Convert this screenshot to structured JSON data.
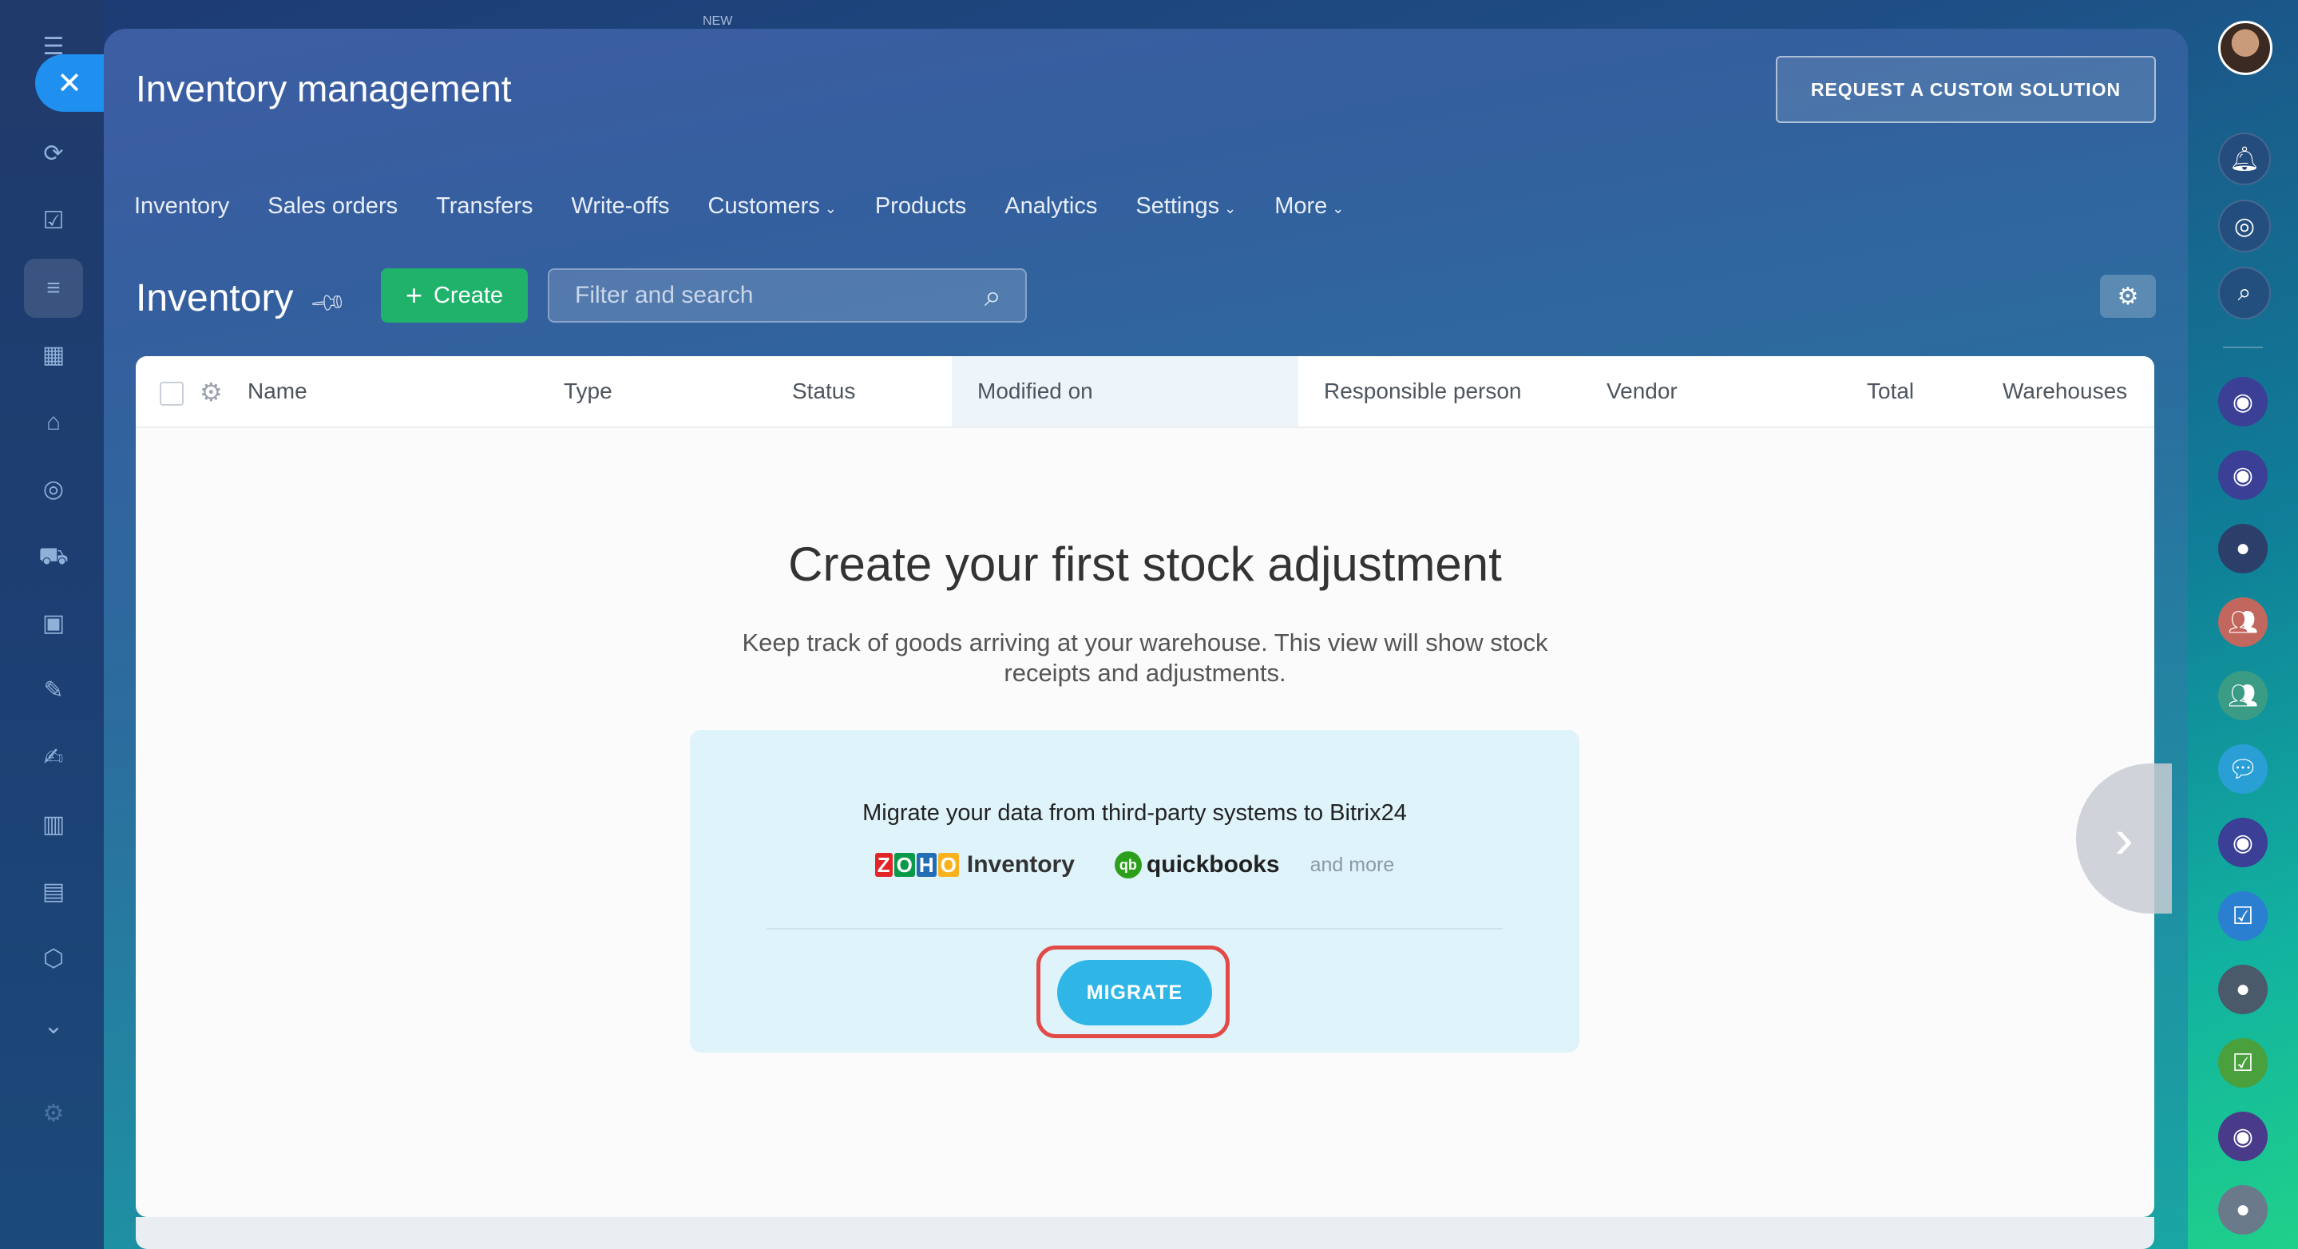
{
  "panel": {
    "title": "Inventory management",
    "request_button": "REQUEST A CUSTOM SOLUTION",
    "new_label": "NEW"
  },
  "topnav": [
    {
      "label": "Inventory"
    },
    {
      "label": "Sales orders"
    },
    {
      "label": "Transfers"
    },
    {
      "label": "Write-offs"
    },
    {
      "label": "Customers",
      "dropdown": true
    },
    {
      "label": "Products"
    },
    {
      "label": "Analytics"
    },
    {
      "label": "Settings",
      "dropdown": true
    },
    {
      "label": "More",
      "dropdown": true
    }
  ],
  "toolbar": {
    "heading": "Inventory",
    "create_label": "Create",
    "search_placeholder": "Filter and search"
  },
  "grid": {
    "columns": [
      "Name",
      "Type",
      "Status",
      "Modified on",
      "Responsible person",
      "Vendor",
      "Total",
      "Warehouses"
    ],
    "sorted_column": "Modified on"
  },
  "empty_state": {
    "title": "Create your first stock adjustment",
    "description": "Keep track of goods arriving at your warehouse. This view will show stock receipts and adjustments.",
    "migrate_text": "Migrate your data from third-party systems to Bitrix24",
    "zoho_word": "Inventory",
    "qb_word": "quickbooks",
    "and_more": "and more",
    "migrate_button": "MIGRATE"
  },
  "left_sidebar_icons": [
    "menu-icon",
    "close-icon",
    "crm-icon",
    "tasks-icon",
    "inventory-icon",
    "calendar-icon",
    "store-icon",
    "target-icon",
    "cart-icon",
    "robot-icon",
    "document-edit-icon",
    "sign-icon",
    "analytics-icon",
    "contact-center-icon",
    "box-icon",
    "chevron-down-icon",
    "settings-icon"
  ],
  "right_sidebar_icons": [
    "user-avatar",
    "bell-icon",
    "target-icon",
    "chat-search-icon",
    "openline-icon",
    "openline-icon",
    "user-avatar",
    "group-icon",
    "group-icon",
    "chat-icon",
    "openline-icon",
    "task-icon",
    "user-avatar",
    "task-done-icon",
    "support-icon",
    "user-avatar"
  ],
  "colors": {
    "accent_green": "#1fb26b",
    "migrate_blue": "#2fb6e6",
    "highlight_red": "#e24a46"
  }
}
